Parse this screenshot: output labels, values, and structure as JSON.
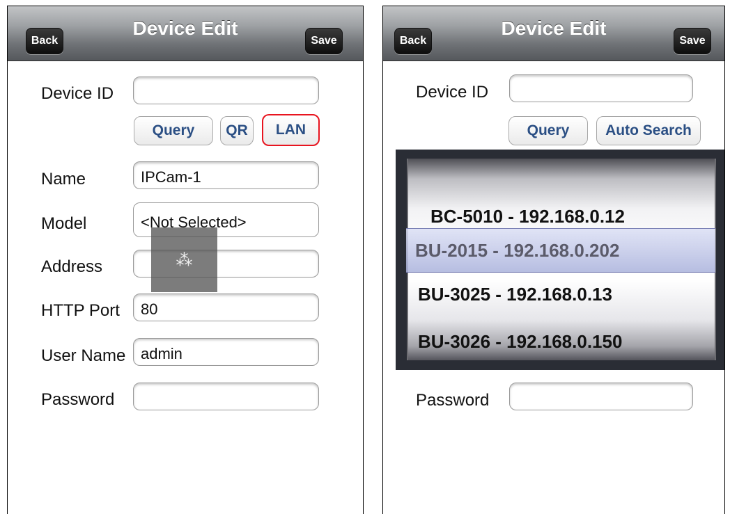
{
  "left": {
    "nav": {
      "back": "Back",
      "title": "Device Edit",
      "save": "Save"
    },
    "fields": {
      "device_id": {
        "label": "Device ID",
        "value": ""
      },
      "name": {
        "label": "Name",
        "value": "IPCam-1"
      },
      "model": {
        "label": "Model",
        "value": "<Not Selected>"
      },
      "address": {
        "label": "Address",
        "value": ""
      },
      "http_port": {
        "label": "HTTP Port",
        "value": "80"
      },
      "user_name": {
        "label": "User Name",
        "value": "admin"
      },
      "password": {
        "label": "Password",
        "value": ""
      }
    },
    "buttons": {
      "query": "Query",
      "qr": "QR",
      "lan": "LAN"
    },
    "spinner": {
      "icon": "loading-spinner-icon",
      "glyph": "⁂"
    },
    "colors": {
      "highlight": "#e8141f",
      "button_text": "#2b4f84"
    }
  },
  "right": {
    "nav": {
      "back": "Back",
      "title": "Device Edit",
      "save": "Save"
    },
    "fields": {
      "device_id": {
        "label": "Device ID",
        "value": ""
      },
      "password": {
        "label": "Password",
        "value": ""
      }
    },
    "buttons": {
      "query": "Query",
      "auto_search": "Auto Search"
    },
    "picker": {
      "items": [
        "BC-5010 - 192.168.0.12",
        "BU-2015 - 192.168.0.202",
        "BU-3025 - 192.168.0.13",
        "BU-3026 - 192.168.0.150"
      ],
      "selected": "BU-2015 - 192.168.0.202"
    }
  }
}
